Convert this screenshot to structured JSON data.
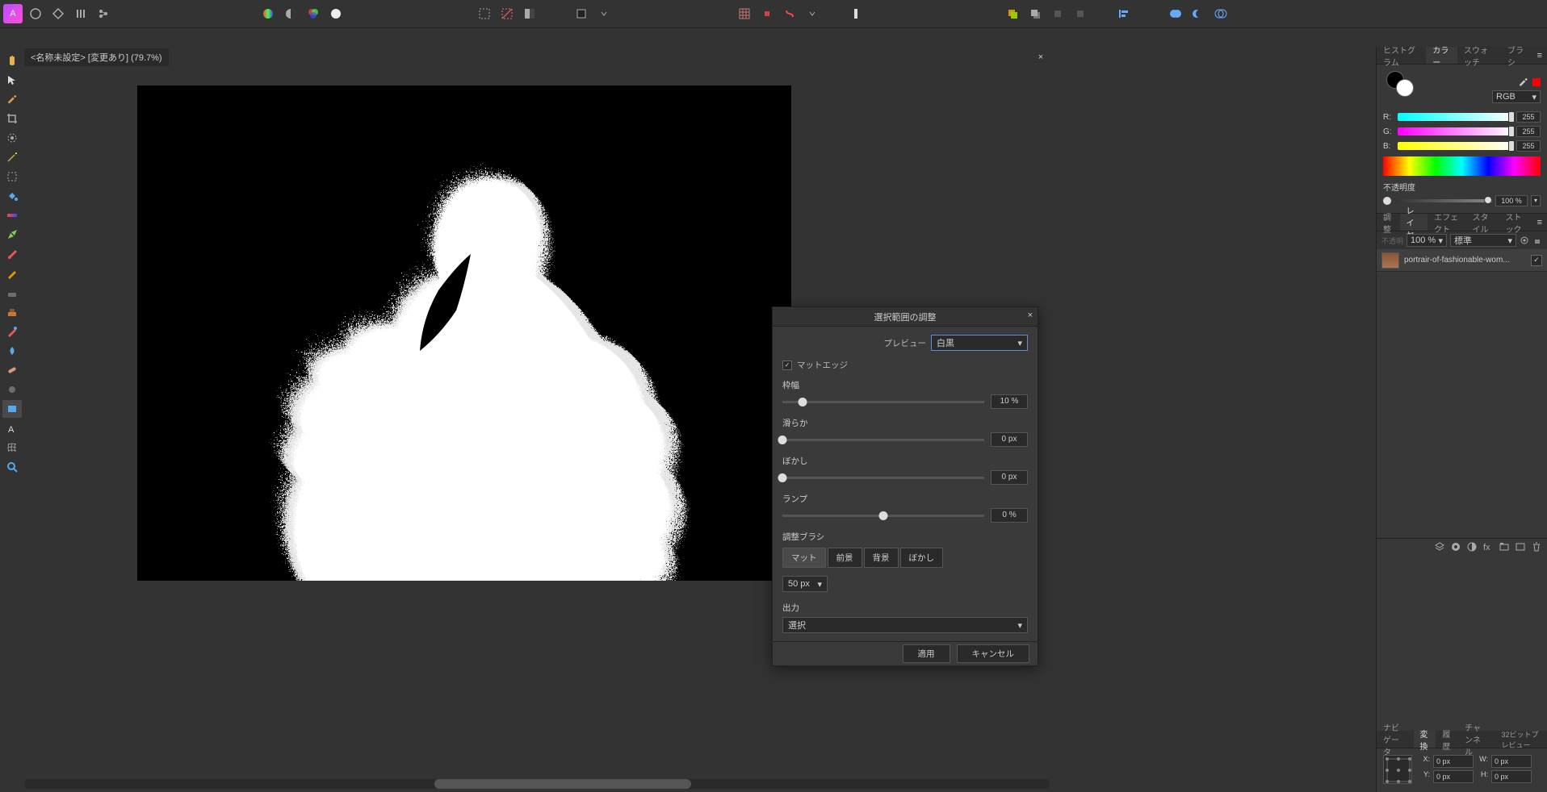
{
  "topbar": {
    "app_initial": "A"
  },
  "document": {
    "tab_title": "<名称未設定> [変更あり] (79.7%)"
  },
  "dialog": {
    "title": "選択範囲の調整",
    "preview_label": "プレビュー",
    "preview_value": "白黒",
    "matte_edge": "マットエッジ",
    "border_label": "枠幅",
    "border_value": "10 %",
    "smooth_label": "滑らか",
    "smooth_value": "0 px",
    "feather_label": "ぼかし",
    "feather_value": "0 px",
    "ramp_label": "ランプ",
    "ramp_value": "0 %",
    "brush_section": "調整ブラシ",
    "brush_matte": "マット",
    "brush_fg": "前景",
    "brush_bg": "背景",
    "brush_feather": "ぼかし",
    "brush_size": "50 px",
    "output_label": "出力",
    "output_value": "選択",
    "apply": "適用",
    "cancel": "キャンセル"
  },
  "panels": {
    "color_tabs": {
      "histogram": "ヒストグラム",
      "color": "カラー",
      "swatch": "スウォッチ",
      "brush": "ブラシ"
    },
    "color_mode": "RGB",
    "rgb": {
      "r_label": "R:",
      "g_label": "G:",
      "b_label": "B:",
      "r": "255",
      "g": "255",
      "b": "255"
    },
    "opacity_label": "不透明度",
    "opacity_value": "100 %",
    "layer_tabs": {
      "adjust": "調整",
      "layer": "レイヤ",
      "effect": "エフェクト",
      "style": "スタイル",
      "stock": "ストック"
    },
    "blend_mode": "標準",
    "layer_opacity": "100 %",
    "layer_name": "portrair-of-fashionable-wom...",
    "nav_tabs": {
      "navigator": "ナビゲータ",
      "transform": "変換",
      "history": "履歴",
      "channel": "チャンネル",
      "preview32": "32ビットプレビュー"
    },
    "transform": {
      "x_label": "X:",
      "y_label": "Y:",
      "w_label": "W:",
      "h_label": "H:",
      "x": "0 px",
      "y": "0 px",
      "w": "0 px",
      "h": "0 px"
    }
  }
}
